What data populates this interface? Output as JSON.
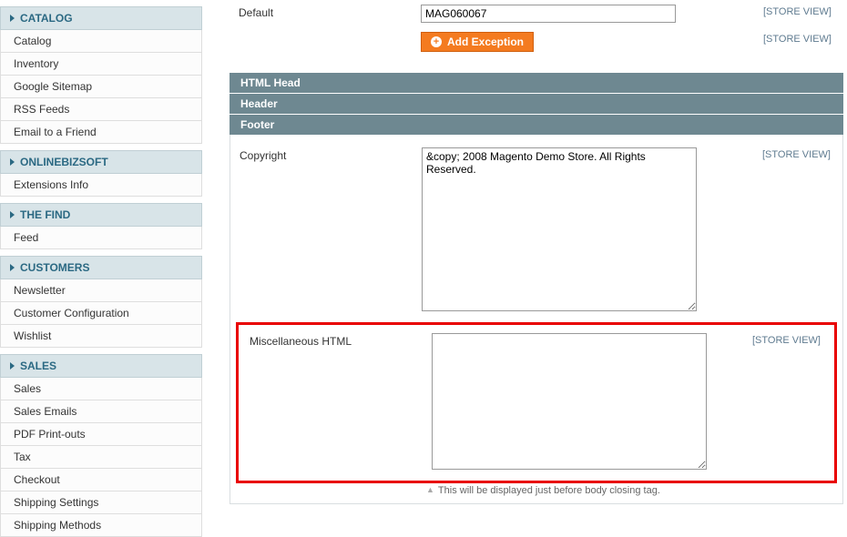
{
  "sidebar": {
    "groups": [
      {
        "title": "CATALOG",
        "items": [
          "Catalog",
          "Inventory",
          "Google Sitemap",
          "RSS Feeds",
          "Email to a Friend"
        ]
      },
      {
        "title": "ONLINEBIZSOFT",
        "items": [
          "Extensions Info"
        ]
      },
      {
        "title": "THE FIND",
        "items": [
          "Feed"
        ]
      },
      {
        "title": "CUSTOMERS",
        "items": [
          "Newsletter",
          "Customer Configuration",
          "Wishlist"
        ]
      },
      {
        "title": "SALES",
        "items": [
          "Sales",
          "Sales Emails",
          "PDF Print-outs",
          "Tax",
          "Checkout",
          "Shipping Settings",
          "Shipping Methods"
        ]
      }
    ]
  },
  "default_row": {
    "label": "Default",
    "value": "MAG060067",
    "scope": "[STORE VIEW]"
  },
  "add_exception": {
    "label": "Add Exception",
    "scope": "[STORE VIEW]"
  },
  "accordions": {
    "html_head": "HTML Head",
    "header": "Header",
    "footer": "Footer"
  },
  "copyright": {
    "label": "Copyright",
    "value": "&copy; 2008 Magento Demo Store. All Rights Reserved.",
    "scope": "[STORE VIEW]"
  },
  "misc_html": {
    "label": "Miscellaneous HTML",
    "value": "",
    "scope": "[STORE VIEW]",
    "hint": "This will be displayed just before body closing tag."
  }
}
